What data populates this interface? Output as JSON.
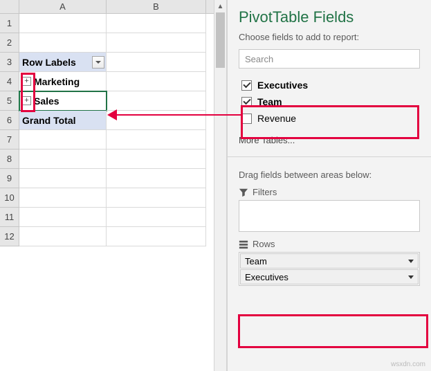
{
  "sheet": {
    "columns": [
      "A",
      "B"
    ],
    "rows": [
      "1",
      "2",
      "3",
      "4",
      "5",
      "6",
      "7",
      "8",
      "9",
      "10",
      "11",
      "12"
    ],
    "pivot": {
      "header_label": "Row Labels",
      "data_rows": [
        "Marketing",
        "Sales"
      ],
      "grand_total": "Grand Total"
    }
  },
  "panel": {
    "title": "PivotTable Fields",
    "subtitle": "Choose fields to add to report:",
    "search_placeholder": "Search",
    "fields": [
      {
        "label": "Executives",
        "checked": true
      },
      {
        "label": "Team",
        "checked": true
      },
      {
        "label": "Revenue",
        "checked": false
      }
    ],
    "more_tables": "More Tables...",
    "areas_label": "Drag fields between areas below:",
    "filters_label": "Filters",
    "rows_label": "Rows",
    "row_fields": [
      "Team",
      "Executives"
    ]
  },
  "watermark": "wsxdn.com"
}
